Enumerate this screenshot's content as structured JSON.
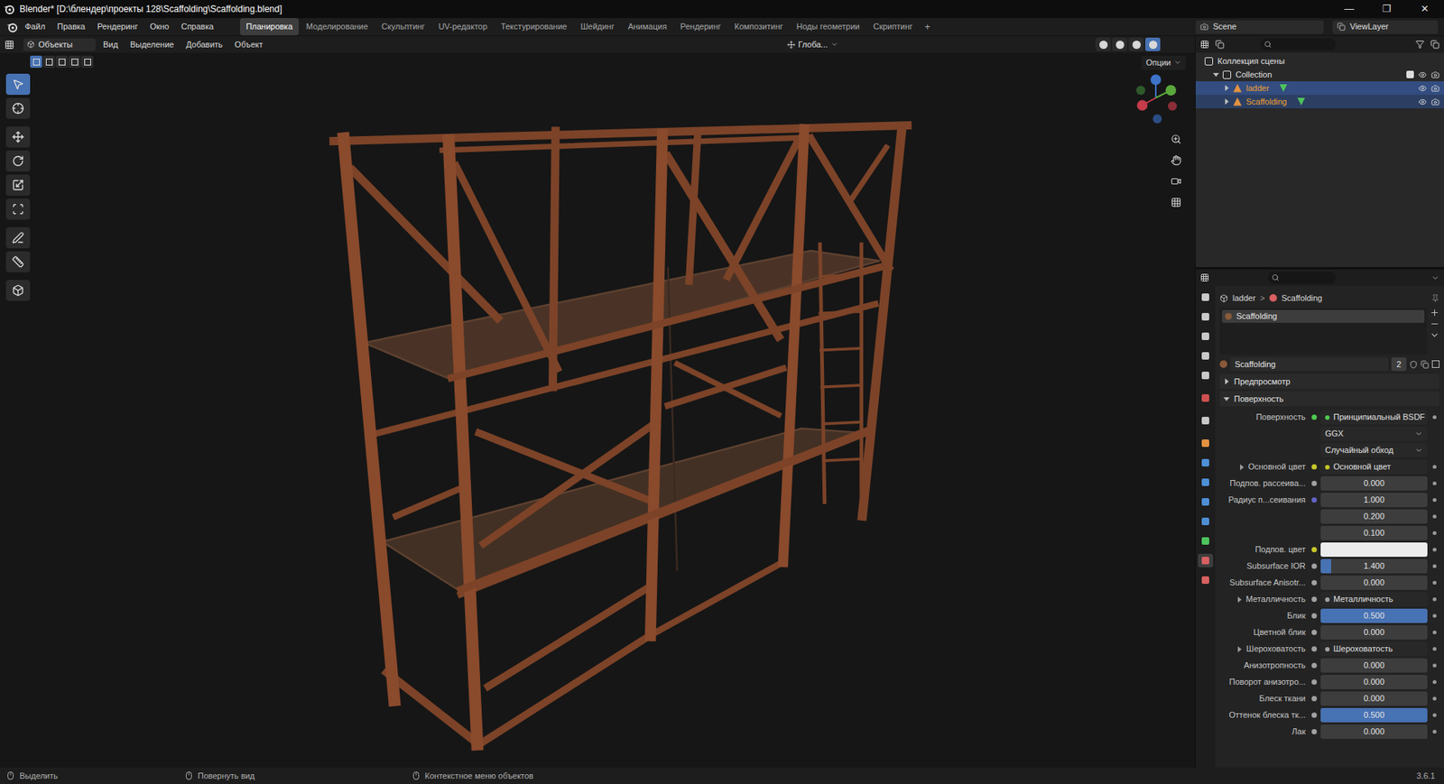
{
  "window": {
    "title": "Blender* [D:\\блендер\\проекты 128\\Scaffolding\\Scaffolding.blend]",
    "controls": [
      "—",
      "❐",
      "✕"
    ]
  },
  "menu": [
    "Файл",
    "Правка",
    "Рендеринг",
    "Окно",
    "Справка"
  ],
  "workspaces": [
    {
      "label": "Планировка",
      "selected": true
    },
    {
      "label": "Моделирование",
      "selected": false
    },
    {
      "label": "Скульптинг",
      "selected": false
    },
    {
      "label": "UV-редактор",
      "selected": false
    },
    {
      "label": "Текстурирование",
      "selected": false
    },
    {
      "label": "Шейдинг",
      "selected": false
    },
    {
      "label": "Анимация",
      "selected": false
    },
    {
      "label": "Рендеринг",
      "selected": false
    },
    {
      "label": "Композитинг",
      "selected": false
    },
    {
      "label": "Ноды геометрии",
      "selected": false
    },
    {
      "label": "Скриптинг",
      "selected": false
    }
  ],
  "add_workspace": "+",
  "scene": "Scene",
  "view_layer": "ViewLayer",
  "viewport": {
    "mode": "Объекты",
    "menus": [
      "Вид",
      "Выделение",
      "Добавить",
      "Объект"
    ],
    "orientation": "Глоба...",
    "options": "Опции",
    "select_modes": [
      {
        "selected": true
      },
      {
        "selected": false
      },
      {
        "selected": false
      },
      {
        "selected": false
      },
      {
        "selected": false
      }
    ],
    "shading_modes": [
      {
        "selected": false
      },
      {
        "selected": false
      },
      {
        "selected": false
      },
      {
        "selected": true
      }
    ],
    "tools": [
      {
        "selected": true
      },
      {
        "selected": false
      },
      {
        "selected": false
      },
      {
        "selected": false
      },
      {
        "selected": false
      },
      {
        "selected": false
      },
      {
        "selected": false
      },
      {
        "selected": false
      },
      {
        "selected": false
      }
    ]
  },
  "outliner": {
    "rows": [
      {
        "label": "Коллекция сцены",
        "depth": 0,
        "kind": "scene",
        "expanded": true,
        "selected": false,
        "active": false
      },
      {
        "label": "Collection",
        "depth": 1,
        "kind": "collection",
        "expanded": true,
        "selected": false,
        "active": false
      },
      {
        "label": "ladder",
        "depth": 2,
        "kind": "object",
        "expanded": false,
        "selected": true,
        "active": true
      },
      {
        "label": "Scaffolding",
        "depth": 2,
        "kind": "object",
        "expanded": false,
        "selected": true,
        "active": false
      }
    ]
  },
  "properties": {
    "tabs": [
      {
        "selected": false
      },
      {
        "selected": false
      },
      {
        "selected": false
      },
      {
        "selected": false
      },
      {
        "selected": false
      },
      {
        "selected": false
      },
      {
        "selected": false
      },
      {
        "selected": false
      },
      {
        "selected": false
      },
      {
        "selected": false
      },
      {
        "selected": false
      },
      {
        "selected": false
      },
      {
        "selected": false
      },
      {
        "selected": true
      },
      {
        "selected": false
      }
    ],
    "breadcrumb": [
      "ladder",
      "Scaffolding"
    ],
    "breadcrumb_separator": ">",
    "slots": [
      {
        "label": "Scaffolding",
        "selected": true
      }
    ],
    "material": {
      "name": "Scaffolding",
      "users": "2"
    },
    "panels": [
      {
        "label": "Предпросмотр",
        "expanded": false
      },
      {
        "label": "Поверхность",
        "expanded": true
      }
    ],
    "rows": [
      {
        "kind": "link",
        "label": "Поверхность",
        "value": "Принципиальный BSDF",
        "socket": "#4ec94e",
        "expandable": false
      },
      {
        "kind": "dropdown",
        "value": "GGX"
      },
      {
        "kind": "dropdown",
        "value": "Случайный обход"
      },
      {
        "kind": "link",
        "label": "Основной цвет",
        "value": "Основной цвет",
        "socket": "#c7c729",
        "expandable": true
      },
      {
        "kind": "value",
        "label": "Подпов. рассеива...",
        "value": "0.000",
        "level": 0,
        "socket": "#a1a1a1"
      },
      {
        "kind": "vector",
        "label": "Радиус п...сеивания",
        "values": [
          "1.000",
          "0.200",
          "0.100"
        ],
        "socket": "#6363c7"
      },
      {
        "kind": "color",
        "label": "Подпов. цвет",
        "color": "#ececec",
        "socket": "#c7c729"
      },
      {
        "kind": "value",
        "label": "Subsurface IOR",
        "value": "1.400",
        "level": 0.1,
        "socket": "#a1a1a1"
      },
      {
        "kind": "value",
        "label": "Subsurface Anisotr...",
        "value": "0.000",
        "level": 0,
        "socket": "#a1a1a1"
      },
      {
        "kind": "link",
        "label": "Металличность",
        "value": "Металличность",
        "socket": "#a1a1a1",
        "expandable": true
      },
      {
        "kind": "value",
        "label": "Блик",
        "value": "0.500",
        "level": 1,
        "socket": "#a1a1a1"
      },
      {
        "kind": "value",
        "label": "Цветной блик",
        "value": "0.000",
        "level": 0,
        "socket": "#a1a1a1"
      },
      {
        "kind": "link",
        "label": "Шероховатость",
        "value": "Шероховатость",
        "socket": "#a1a1a1",
        "expandable": true
      },
      {
        "kind": "value",
        "label": "Анизотропность",
        "value": "0.000",
        "level": 0,
        "socket": "#a1a1a1"
      },
      {
        "kind": "value",
        "label": "Поворот анизотро...",
        "value": "0.000",
        "level": 0,
        "socket": "#a1a1a1"
      },
      {
        "kind": "value",
        "label": "Блеск ткани",
        "value": "0.000",
        "level": 0,
        "socket": "#a1a1a1"
      },
      {
        "kind": "value",
        "label": "Оттенок блеска тк...",
        "value": "0.500",
        "level": 1,
        "socket": "#a1a1a1"
      },
      {
        "kind": "value",
        "label": "Лак",
        "value": "0.000",
        "level": 0,
        "socket": "#a1a1a1"
      }
    ]
  },
  "status_bar": {
    "hints": [
      "Выделить",
      "Повернуть вид",
      "Контекстное меню объектов"
    ],
    "version": "3.6.1"
  }
}
